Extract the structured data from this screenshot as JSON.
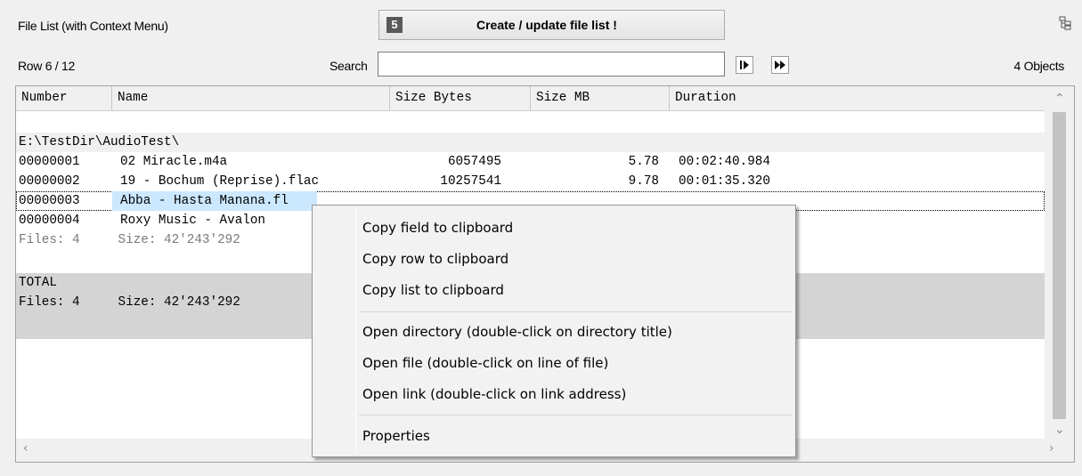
{
  "header": {
    "title": "File List (with Context Menu)",
    "create_button": {
      "number": "5",
      "label": "Create / update file list !"
    },
    "tree_icon": "tree-view-icon"
  },
  "toolbar": {
    "row_status": "Row 6 / 12",
    "search_label": "Search",
    "search_value": "",
    "nav_icons": [
      "play-next-icon",
      "fast-forward-icon"
    ],
    "objects_count": "4 Objects"
  },
  "table": {
    "columns": [
      "Number",
      "Name",
      "Size Bytes",
      "Size MB",
      "Duration"
    ],
    "directory": "E:\\TestDir\\AudioTest\\",
    "rows": [
      {
        "number": "00000001",
        "name": "02 Miracle.m4a",
        "bytes": "6057495",
        "mb": "5.78",
        "duration": "00:02:40.984"
      },
      {
        "number": "00000002",
        "name": "19 - Bochum (Reprise).flac",
        "bytes": "10257541",
        "mb": "9.78",
        "duration": "00:01:35.320"
      },
      {
        "number": "00000003",
        "name": "Abba - Hasta Manana.fl",
        "bytes": "",
        "mb": "",
        "duration": ""
      },
      {
        "number": "00000004",
        "name": "Roxy Music - Avalon",
        "bytes": "",
        "mb": "",
        "duration": ""
      }
    ],
    "subtotal": "Files: 4     Size: 42'243'292",
    "total_label": "TOTAL",
    "total_line": "Files: 4     Size: 42'243'292"
  },
  "context_menu": {
    "items": [
      "Copy field to clipboard",
      "Copy row to clipboard",
      "Copy list to clipboard",
      "Open directory  (double-click on directory title)",
      "Open file  (double-click on line of file)",
      "Open link  (double-click on link address)",
      "Properties"
    ]
  }
}
